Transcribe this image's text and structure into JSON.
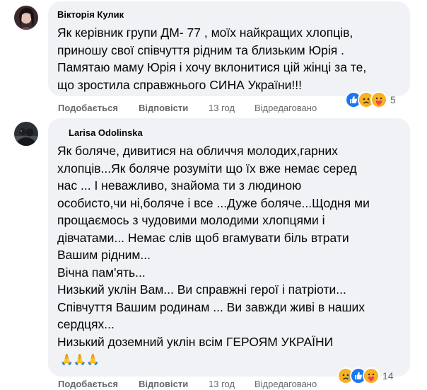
{
  "comments": [
    {
      "author": "Вікторія Кулик",
      "text": "Як керівник групи ДМ- 77 , моїх найкращих хлопців,\nприношу свої співчуття рідним та близьким Юрія .\nПамятаю маму Юрія і хочу вклонитися цій жінці за те,\nщо зростила справжнього СИНА України!!!",
      "like_label": "Подобається",
      "reply_label": "Відповісти",
      "time": "13 год",
      "edited": "Відредаговано",
      "reaction_count": "5",
      "reactions": [
        "like",
        "sad",
        "care"
      ]
    },
    {
      "author": "Larisa Odolinska",
      "text": "Як боляче, дивитися на обличчя молодих,гарних\nхлопців...Як боляче розуміти що їх вже немає серед\nнас ... І неважливо, знайома ти з людиною\nособисто,чи ні,боляче і все ...Дуже боляче...Щодня ми\nпрощаємось з чудовими молодими хлопцями і\nдівчатами... Немає слів щоб вгамувати біль втрати\nВашим рідним...\nВічна пам'ять...\nНизький уклін Вам... Ви справжні герої і патріоти...\nСпівчуття Вашим родинам ... Ви завжди живі в наших\nсердцях...\nНизький доземний уклін всім ГЕРОЯМ УКРАЇНИ",
      "emoji_line": "🙏🙏🙏",
      "like_label": "Подобається",
      "reply_label": "Відповісти",
      "time": "13 год",
      "edited": "Відредаговано",
      "reaction_count": "14",
      "reactions": [
        "sad",
        "like",
        "care"
      ]
    }
  ],
  "colors": {
    "bubble": "#f0f2f5",
    "meta": "#65676b",
    "like_blue": "#1877f2",
    "sad_yellow": "#f7b125",
    "care_red": "#f33e58"
  }
}
